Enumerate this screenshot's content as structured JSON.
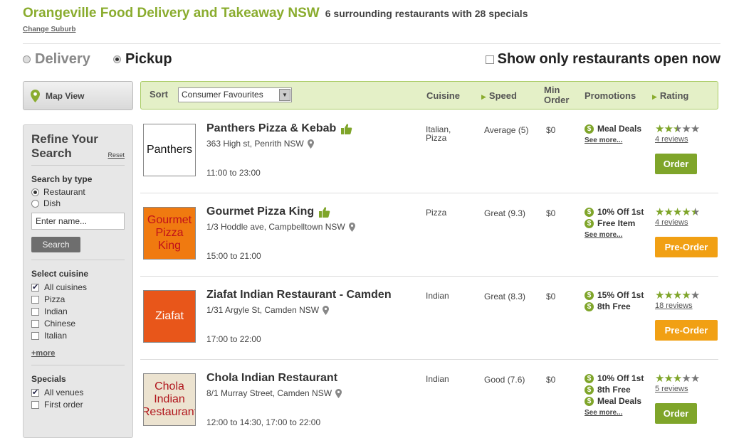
{
  "header": {
    "title": "Orangeville Food Delivery and Takeaway NSW",
    "subtitle": "6 surrounding restaurants with 28 specials",
    "change_suburb": "Change Suburb"
  },
  "mode": {
    "delivery_label": "Delivery",
    "pickup_label": "Pickup",
    "selected": "Pickup",
    "open_now_label": "Show only restaurants open now"
  },
  "map_view": {
    "label": "Map View"
  },
  "sidebar": {
    "title": "Refine Your Search",
    "reset": "Reset",
    "search_by_type": "Search by type",
    "type_options": [
      "Restaurant",
      "Dish"
    ],
    "name_placeholder": "Enter name...",
    "search_button": "Search",
    "cuisine_heading": "Select cuisine",
    "cuisines": [
      {
        "label": "All cuisines",
        "checked": true
      },
      {
        "label": "Pizza",
        "checked": false
      },
      {
        "label": "Indian",
        "checked": false
      },
      {
        "label": "Chinese",
        "checked": false
      },
      {
        "label": "Italian",
        "checked": false
      }
    ],
    "more": "+more",
    "specials_heading": "Specials",
    "specials": [
      {
        "label": "All venues",
        "checked": true
      },
      {
        "label": "First order",
        "checked": false
      }
    ]
  },
  "sortbar": {
    "sort_label": "Sort",
    "sort_value": "Consumer Favourites",
    "cuisine": "Cuisine",
    "speed": "Speed",
    "min_order_line1": "Min",
    "min_order_line2": "Order",
    "promotions": "Promotions",
    "rating": "Rating"
  },
  "restaurants": [
    {
      "logo_text": "Panthers",
      "name": "Panthers Pizza & Kebab",
      "address": "363 High st, Penrith NSW",
      "hours": "11:00 to 23:00",
      "cuisine_line1": "Italian,",
      "cuisine_line2": "Pizza",
      "speed": "Average (5)",
      "min_order": "$0",
      "promos": [
        "Meal Deals"
      ],
      "see_more": "See more...",
      "rating": 2.5,
      "reviews": "4 reviews",
      "action": "Order"
    },
    {
      "logo_text": "Gourmet Pizza King",
      "name": "Gourmet Pizza King",
      "address": "1/3 Hoddle ave, Campbelltown NSW",
      "hours": "15:00 to 21:00",
      "cuisine_line1": "Pizza",
      "cuisine_line2": "",
      "speed": "Great (9.3)",
      "min_order": "$0",
      "promos": [
        "10% Off 1st",
        "Free Item"
      ],
      "see_more": "See more...",
      "rating": 4.5,
      "reviews": "4 reviews",
      "action": "Pre-Order"
    },
    {
      "logo_text": "Ziafat",
      "name": "Ziafat Indian Restaurant - Camden",
      "address": "1/31 Argyle St, Camden NSW",
      "hours": "17:00 to 22:00",
      "cuisine_line1": "Indian",
      "cuisine_line2": "",
      "speed": "Great (8.3)",
      "min_order": "$0",
      "promos": [
        "15% Off 1st",
        "8th Free"
      ],
      "see_more": "",
      "rating": 4,
      "reviews": "18 reviews",
      "action": "Pre-Order"
    },
    {
      "logo_text": "Chola Indian Restaurant",
      "name": "Chola Indian Restaurant",
      "address": "8/1 Murray Street, Camden NSW",
      "hours": "12:00 to 14:30, 17:00 to 22:00",
      "cuisine_line1": "Indian",
      "cuisine_line2": "",
      "speed": "Good (7.6)",
      "min_order": "$0",
      "promos": [
        "10% Off 1st",
        "8th Free",
        "Meal Deals"
      ],
      "see_more": "See more...",
      "rating": 3,
      "reviews": "5 reviews",
      "action": "Order"
    }
  ],
  "colors": {
    "brand_green": "#8aac2e",
    "order_green": "#7fa52a",
    "preorder_orange": "#f1a014",
    "star_filled": "#7fa52a",
    "star_empty": "#777777"
  },
  "icons": {
    "map_pin": "map-pin-icon",
    "thumbs_up": "thumbs-up-icon",
    "dollar": "dollar-icon",
    "star": "star-icon"
  }
}
